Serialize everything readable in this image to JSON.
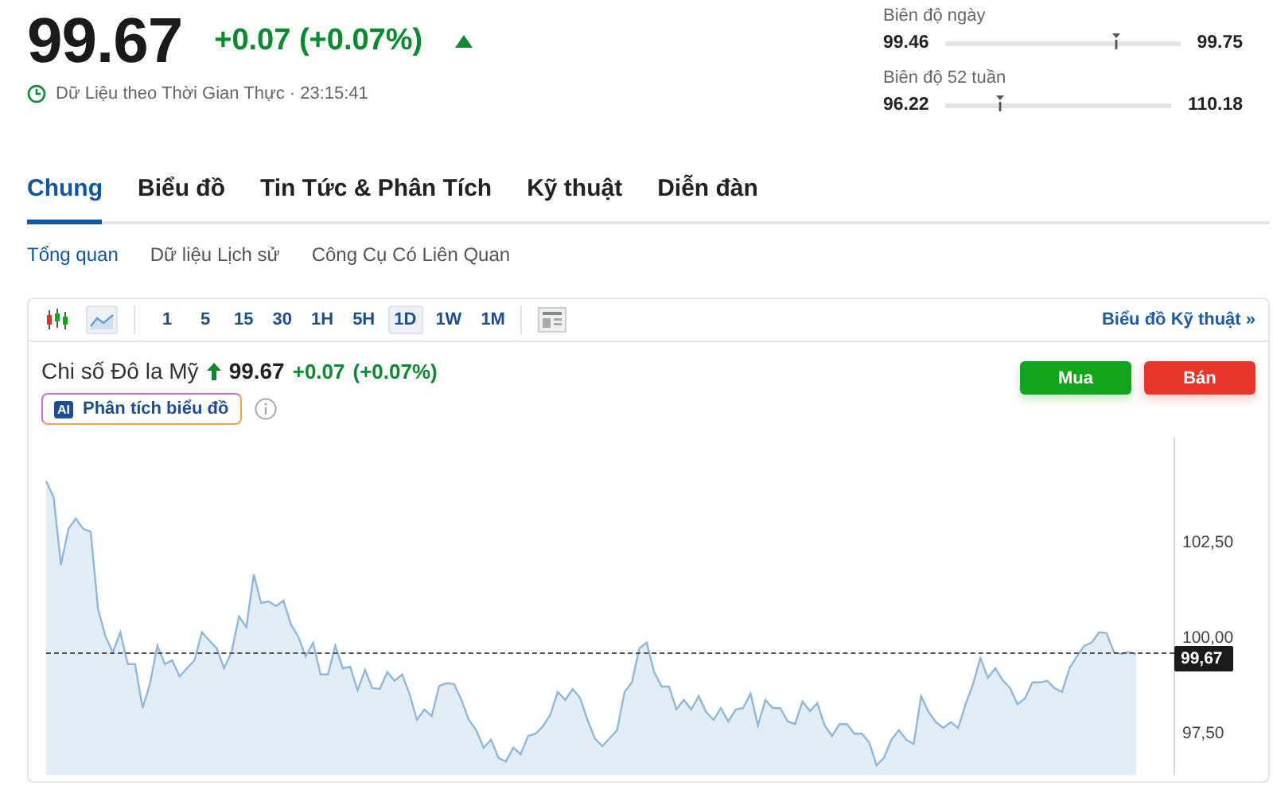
{
  "quote": {
    "price": "99.67",
    "change": "+0.07 (+0.07%)",
    "status": "Dữ Liệu theo Thời Gian Thực · 23:15:41"
  },
  "ranges": [
    {
      "label": "Biên độ ngày",
      "low": "99.46",
      "high": "99.75",
      "level": 0.72
    },
    {
      "label": "Biên độ 52 tuần",
      "low": "96.22",
      "high": "110.18",
      "level": 0.24
    }
  ],
  "tabs": [
    {
      "label": "Chung",
      "selected": true
    },
    {
      "label": "Biểu đồ",
      "selected": false
    },
    {
      "label": "Tin Tức & Phân Tích",
      "selected": false
    },
    {
      "label": "Kỹ thuật",
      "selected": false
    },
    {
      "label": "Diễn đàn",
      "selected": false
    }
  ],
  "subtabs": [
    {
      "label": "Tổng quan",
      "selected": true
    },
    {
      "label": "Dữ liệu Lịch sử",
      "selected": false
    },
    {
      "label": "Công Cụ Có Liên Quan",
      "selected": false
    }
  ],
  "chart_panel": {
    "chart_types": [
      {
        "kind": "candles",
        "selected": false
      },
      {
        "kind": "line",
        "selected": true
      }
    ],
    "intervals": [
      {
        "label": "1",
        "selected": false
      },
      {
        "label": "5",
        "selected": false
      },
      {
        "label": "15",
        "selected": false
      },
      {
        "label": "30",
        "selected": false
      },
      {
        "label": "1H",
        "selected": false
      },
      {
        "label": "5H",
        "selected": false
      },
      {
        "label": "1D",
        "selected": true
      },
      {
        "label": "1W",
        "selected": false
      },
      {
        "label": "1M",
        "selected": false
      }
    ],
    "technical_link": "Biểu đồ Kỹ thuật »",
    "instrument": "Chi số Đô la Mỹ",
    "price": "99.67",
    "change": "+0.07",
    "change_pct": "(+0.07%)",
    "ai_button": "Phân tích biểu đồ",
    "ai_badge": "AI",
    "buy": "Mua",
    "sell": "Bán",
    "last_price_marker": {
      "label": "99,67"
    },
    "chart_data": {
      "type": "area",
      "ylim": [
        96.5,
        105.33
      ],
      "yticks": [
        {
          "value": 97.5,
          "label": "97,50"
        },
        {
          "value": 100,
          "label": "100,00"
        },
        {
          "value": 102.5,
          "label": "102,50"
        }
      ],
      "series": [
        {
          "color": "#8fb8dc",
          "values": [
            104.19,
            103.77,
            102.0,
            102.94,
            103.21,
            102.94,
            102.87,
            100.85,
            100.12,
            99.71,
            100.23,
            99.4,
            99.4,
            98.25,
            98.88,
            99.88,
            99.4,
            99.5,
            99.08,
            99.29,
            99.5,
            100.23,
            100.02,
            99.81,
            99.29,
            99.71,
            100.65,
            100.37,
            101.75,
            101.0,
            101.04,
            100.92,
            101.06,
            100.44,
            100.12,
            99.6,
            99.96,
            99.13,
            99.13,
            99.88,
            99.29,
            99.33,
            98.71,
            99.25,
            98.77,
            98.75,
            99.19,
            98.96,
            99.13,
            98.63,
            97.94,
            98.21,
            98.04,
            98.83,
            98.9,
            98.88,
            98.46,
            97.94,
            97.67,
            97.21,
            97.42,
            96.94,
            96.85,
            97.21,
            97.04,
            97.52,
            97.58,
            97.77,
            98.08,
            98.67,
            98.46,
            98.75,
            98.52,
            97.94,
            97.46,
            97.25,
            97.46,
            97.67,
            98.67,
            98.92,
            99.81,
            99.96,
            99.19,
            98.81,
            98.81,
            98.21,
            98.46,
            98.21,
            98.56,
            98.15,
            97.94,
            98.25,
            97.9,
            98.21,
            98.25,
            98.63,
            97.79,
            98.46,
            98.25,
            98.25,
            97.9,
            97.83,
            98.42,
            98.17,
            98.38,
            97.79,
            97.52,
            97.83,
            97.83,
            97.58,
            97.58,
            97.35,
            96.75,
            96.96,
            97.42,
            97.67,
            97.42,
            97.31,
            98.56,
            98.15,
            97.88,
            97.73,
            97.88,
            97.73,
            98.35,
            98.88,
            99.56,
            99.04,
            99.29,
            98.98,
            98.77,
            98.35,
            98.5,
            98.92,
            98.92,
            98.96,
            98.77,
            98.67,
            99.29,
            99.6,
            99.88,
            99.96,
            100.23,
            100.21,
            99.71,
            99.67,
            99.71,
            99.67
          ]
        }
      ]
    }
  }
}
